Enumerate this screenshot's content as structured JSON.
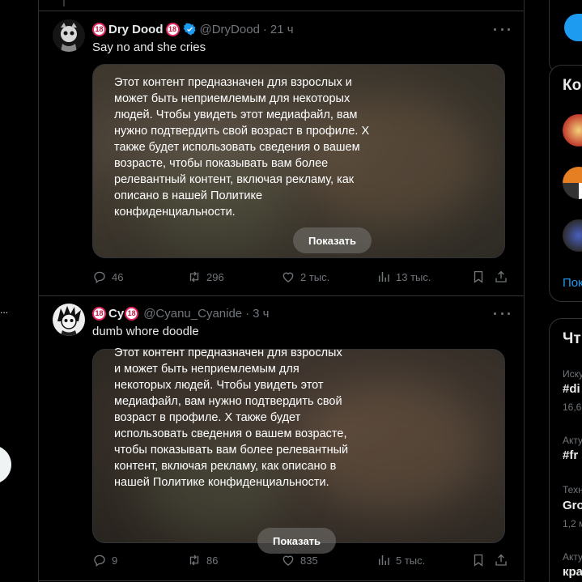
{
  "left_nav": {
    "dots": "..."
  },
  "tweets": [
    {
      "author_name": "Dry Dood",
      "age_badge": "18",
      "handle": "@DryDood",
      "time": "21 ч",
      "text": "Say no and she cries",
      "sensitive_notice": "Этот контент предназначен для взрослых и может быть неприемлемым для некоторых людей. Чтобы увидеть этот медиафайл, вам нужно подтвердить свой возраст в профиле. X также будет использовать сведения о вашем возрасте, чтобы показывать вам более релевантный контент, включая рекламу, как описано в нашей Политике конфиденциальности.",
      "show_button": "Показать",
      "replies": "46",
      "reposts": "296",
      "likes": "2 тыс.",
      "views": "13 тыс."
    },
    {
      "author_name": "Cy",
      "age_badge": "18",
      "handle": "@Cyanu_Cyanide",
      "time": "3 ч",
      "text": "dumb whore doodle",
      "sensitive_notice": "Этот контент предназначен для взрослых и может быть неприемлемым для некоторых людей. Чтобы увидеть этот медиафайл, вам нужно подтвердить свой возраст в профиле. X также будет использовать сведения о вашем возрасте, чтобы показывать вам более релевантный контент, включая рекламу, как описано в нашей Политике конфиденциальности.",
      "show_button": "Показать",
      "replies": "9",
      "reposts": "86",
      "likes": "835",
      "views": "5 тыс."
    }
  ],
  "sidebar": {
    "who_to_follow_title": "Ко",
    "show_more": "Пок",
    "trends_title": "Чт",
    "trends": [
      {
        "context": "Иску",
        "tag": "#di",
        "count": "16,6"
      },
      {
        "context": "Акту",
        "tag": "#fr",
        "count": ""
      },
      {
        "context": "Техн",
        "tag": "Gro",
        "count": "1,2 м"
      },
      {
        "context": "Акту",
        "tag": "кра",
        "count": ""
      }
    ]
  },
  "colors": {
    "accent": "#1d9bf0",
    "border": "#2f3336",
    "muted": "#71767b",
    "age_badge": "#e0245e"
  }
}
